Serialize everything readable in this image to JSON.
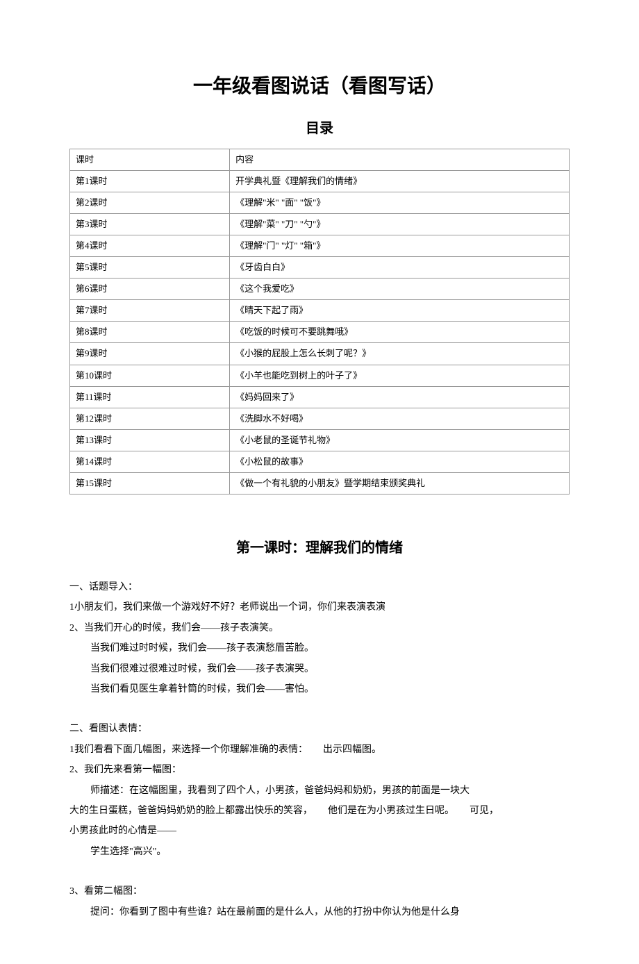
{
  "title": "一年级看图说话（看图写话）",
  "toc_heading": "目录",
  "table": {
    "header": {
      "c1": "课时",
      "c2": "内容"
    },
    "rows": [
      {
        "c1": "第1课时",
        "c2": "开学典礼暨《理解我们的情绪》"
      },
      {
        "c1": "第2课时",
        "c2": "《理解\"米\"  \"面\"  \"饭\"》"
      },
      {
        "c1": "第3课时",
        "c2": "《理解\"菜\"  \"刀\"  \"勺\"》"
      },
      {
        "c1": "第4课时",
        "c2": "《理解\"门\"  \"灯\"  \"箱\"》"
      },
      {
        "c1": "第5课时",
        "c2": "《牙齿白白》"
      },
      {
        "c1": "第6课时",
        "c2": "《这个我爱吃》"
      },
      {
        "c1": "第7课时",
        "c2": "《晴天下起了雨》"
      },
      {
        "c1": "第8课时",
        "c2": "《吃饭的时候可不要跳舞哦》"
      },
      {
        "c1": "第9课时",
        "c2": "《小猴的屁股上怎么长刺了呢？》"
      },
      {
        "c1": "第10课时",
        "c2": "《小羊也能吃到树上的叶子了》"
      },
      {
        "c1": "第11课时",
        "c2": "《妈妈回来了》"
      },
      {
        "c1": "第12课时",
        "c2": "《洗脚水不好喝》"
      },
      {
        "c1": "第13课时",
        "c2": "《小老鼠的圣诞节礼物》"
      },
      {
        "c1": "第14课时",
        "c2": "《小松鼠的故事》"
      },
      {
        "c1": "第15课时",
        "c2": "《做一个有礼貌的小朋友》暨学期结束颁奖典礼"
      }
    ]
  },
  "lesson1": {
    "title": "第一课时：理解我们的情绪",
    "sec1_h": "一、话题导入：",
    "sec1_l1": "1小朋友们，我们来做一个游戏好不好？老师说出一个词，你们来表演表演",
    "sec1_l2": "2、当我们开心的时候，我们会——孩子表演笑。",
    "sec1_l3": "当我们难过时时候，我们会——孩子表演愁眉苦脸。",
    "sec1_l4": "当我们很难过很难过时候，我们会——孩子表演哭。",
    "sec1_l5": "当我们看见医生拿着针筒的时候，我们会——害怕。",
    "sec2_h": "二、看图认表情：",
    "sec2_l1a": "1我们看看下面几幅图，来选择一个你理解准确的表情：",
    "sec2_l1b": "出示四幅图。",
    "sec2_l2": "2、我们先来看第一幅图：",
    "sec2_l3a": "师描述：在这幅图里，我看到了四个人，小男孩，爸爸妈妈和奶奶，男孩的前面是一块大",
    "sec2_l3b": "大的生日蛋糕，爸爸妈妈奶奶的脸上都露出快乐的笑容，",
    "sec2_l3c": "他们是在为小男孩过生日呢。",
    "sec2_l3d": "可见，",
    "sec2_l3e": "小男孩此时的心情是——",
    "sec2_l4": "学生选择\"高兴\"。",
    "sec2_l5": "3、看第二幅图：",
    "sec2_l6": "提问：你看到了图中有些谁？站在最前面的是什么人，从他的打扮中你认为他是什么身"
  }
}
